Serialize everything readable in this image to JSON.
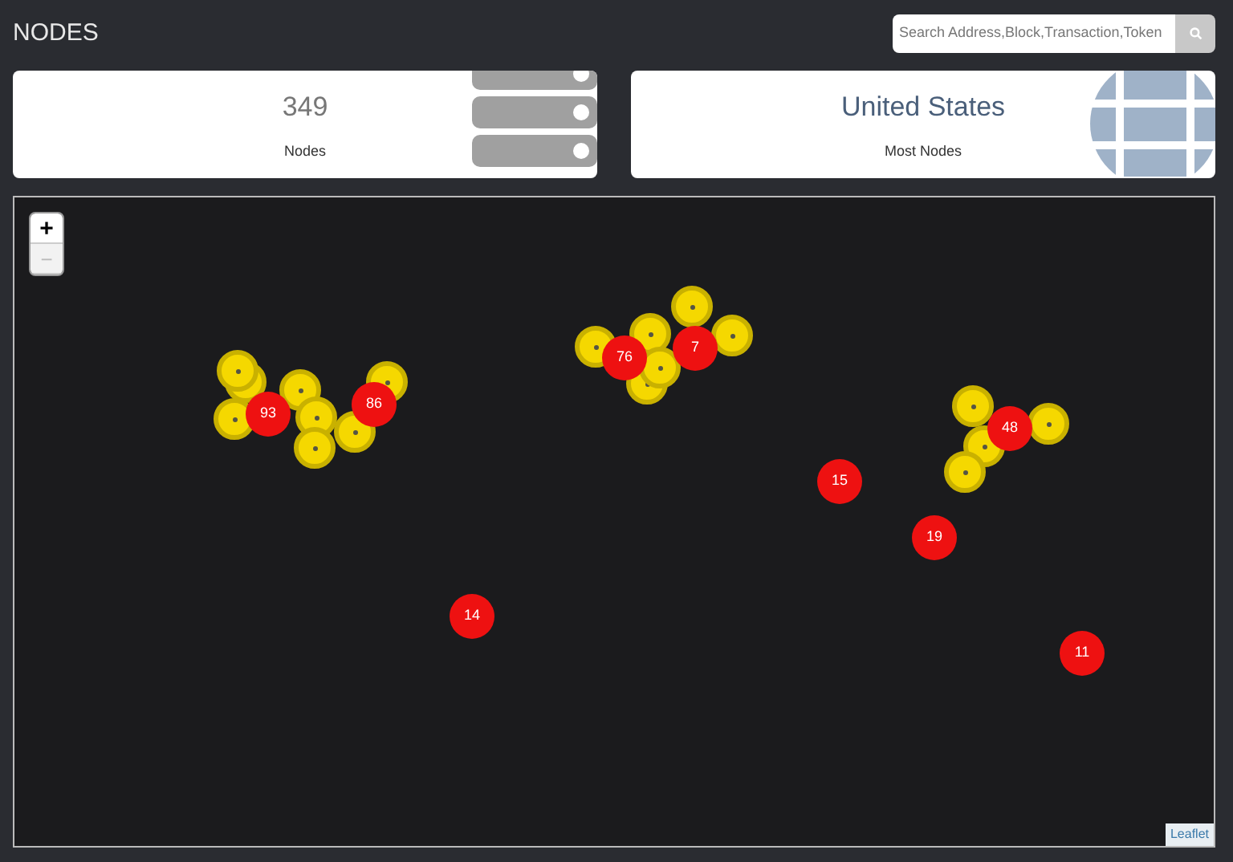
{
  "page_title": "NODES",
  "search": {
    "placeholder": "Search Address,Block,Transaction,Token"
  },
  "stats": [
    {
      "kind": "servers",
      "value": "349",
      "label": "Nodes"
    },
    {
      "kind": "globe",
      "value": "United States",
      "label": "Most Nodes"
    }
  ],
  "map": {
    "zoom_controls": [
      {
        "label": "+",
        "disabled": false
      },
      {
        "label": "−",
        "disabled": true
      }
    ],
    "clusters": [
      "93",
      "86",
      "76",
      "7",
      "15",
      "48",
      "19",
      "14",
      "11"
    ],
    "attribution": "Leaflet"
  }
}
